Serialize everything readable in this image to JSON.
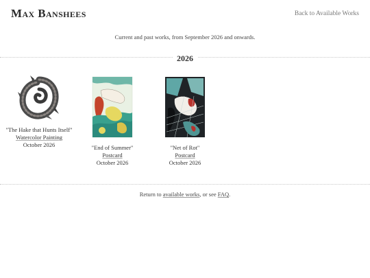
{
  "header": {
    "site_title": "Max Banshees",
    "back_link": "Back to Available Works"
  },
  "intro": "Current and past works, from September 2026 and onwards.",
  "year": "2026",
  "works": [
    {
      "title": "\"The Hake that Hunts Itself\"",
      "medium": "Watercolor Painting",
      "date": "October 2026"
    },
    {
      "title": "\"End of Summer\"",
      "medium": "Postcard",
      "date": "October 2026"
    },
    {
      "title": "\"Net of Rot\"",
      "medium": "Postcard",
      "date": "October 2026"
    }
  ],
  "footer": {
    "prefix": "Return to ",
    "link1": "available works",
    "middle": ", or see ",
    "link2": "FAQ",
    "suffix": "."
  }
}
